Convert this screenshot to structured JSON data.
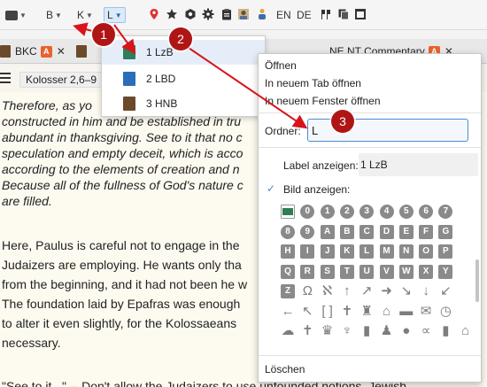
{
  "toolbar": {
    "b_label": "B",
    "k_label": "K",
    "l_label": "L",
    "lang_en": "EN",
    "lang_de": "DE",
    "icons": [
      "laptop-icon",
      "map-pin-icon",
      "star-icon",
      "shield-icon",
      "gear-icon",
      "clipboard-icon",
      "portrait-icon",
      "person-icon",
      "flags-icon",
      "copy-icon"
    ]
  },
  "tabs": [
    {
      "label": "BKC",
      "badge": "A"
    },
    {
      "label": "NE NT Commentary",
      "badge": "A"
    }
  ],
  "content": {
    "passage_ref": "Kolosser 2,6–9",
    "italic_lines": [
      "Therefore, as yo",
      "constructed in him and be established in tru",
      "abundant in thanksgiving. See to it that no c",
      "speculation and empty deceit, which is acco",
      "according to the elements of creation and n",
      "Because all of the fullness of God's nature c",
      "are filled."
    ],
    "body_lines": [
      "Here, Paulus is careful not to engage in the",
      "Judaizers are employing. He wants only tha",
      "from the beginning, and it had not been he w",
      "The foundation laid by Epafras was enough",
      "to alter it even slightly, for the Kolossaeans",
      "necessary."
    ],
    "last_line": "\"See to it...\" -- Don't allow the Judaizers to use unfounded notions, Jewish"
  },
  "dropdown": {
    "items": [
      {
        "label": "1 LzB",
        "color": "#2f7d5a"
      },
      {
        "label": "2 LBD",
        "color": "#2a6db8"
      },
      {
        "label": "3 HNB",
        "color": "#6b4a2b"
      }
    ]
  },
  "context_menu": {
    "open": "Öffnen",
    "open_tab": "In neuem Tab öffnen",
    "open_window": "In neuem Fenster öffnen",
    "folder_label": "Ordner:",
    "folder_value": "L",
    "show_label": "Label anzeigen:",
    "label_value": "1 LzB",
    "show_image": "Bild anzeigen:",
    "check": "✓",
    "delete": "Löschen",
    "picker_rows": [
      [
        "img",
        "0",
        "1",
        "2",
        "3",
        "4",
        "5",
        "6",
        "7"
      ],
      [
        "8",
        "9",
        "A",
        "B",
        "C",
        "D",
        "E",
        "F",
        "G"
      ],
      [
        "H",
        "I",
        "J",
        "K",
        "L",
        "M",
        "N",
        "O",
        "P"
      ],
      [
        "Q",
        "R",
        "S",
        "T",
        "U",
        "V",
        "W",
        "X",
        "Y"
      ],
      [
        "Z",
        "Ω",
        "ℵ",
        "↑",
        "↗",
        "➜",
        "↘",
        "↓",
        "↙"
      ],
      [
        "←",
        "↖",
        "[ ]",
        "✝",
        "♜",
        "⌂",
        "▬",
        "✉",
        "◷"
      ],
      [
        "☁",
        "✝",
        "♛",
        "♆",
        "▮",
        "♟",
        "●",
        "∝",
        "▮",
        "⌂"
      ]
    ]
  },
  "annotations": [
    "1",
    "2",
    "3"
  ],
  "colors": {
    "accent": "#4a8bd6",
    "badge": "#b01515",
    "tab_badge": "#e8622e"
  }
}
